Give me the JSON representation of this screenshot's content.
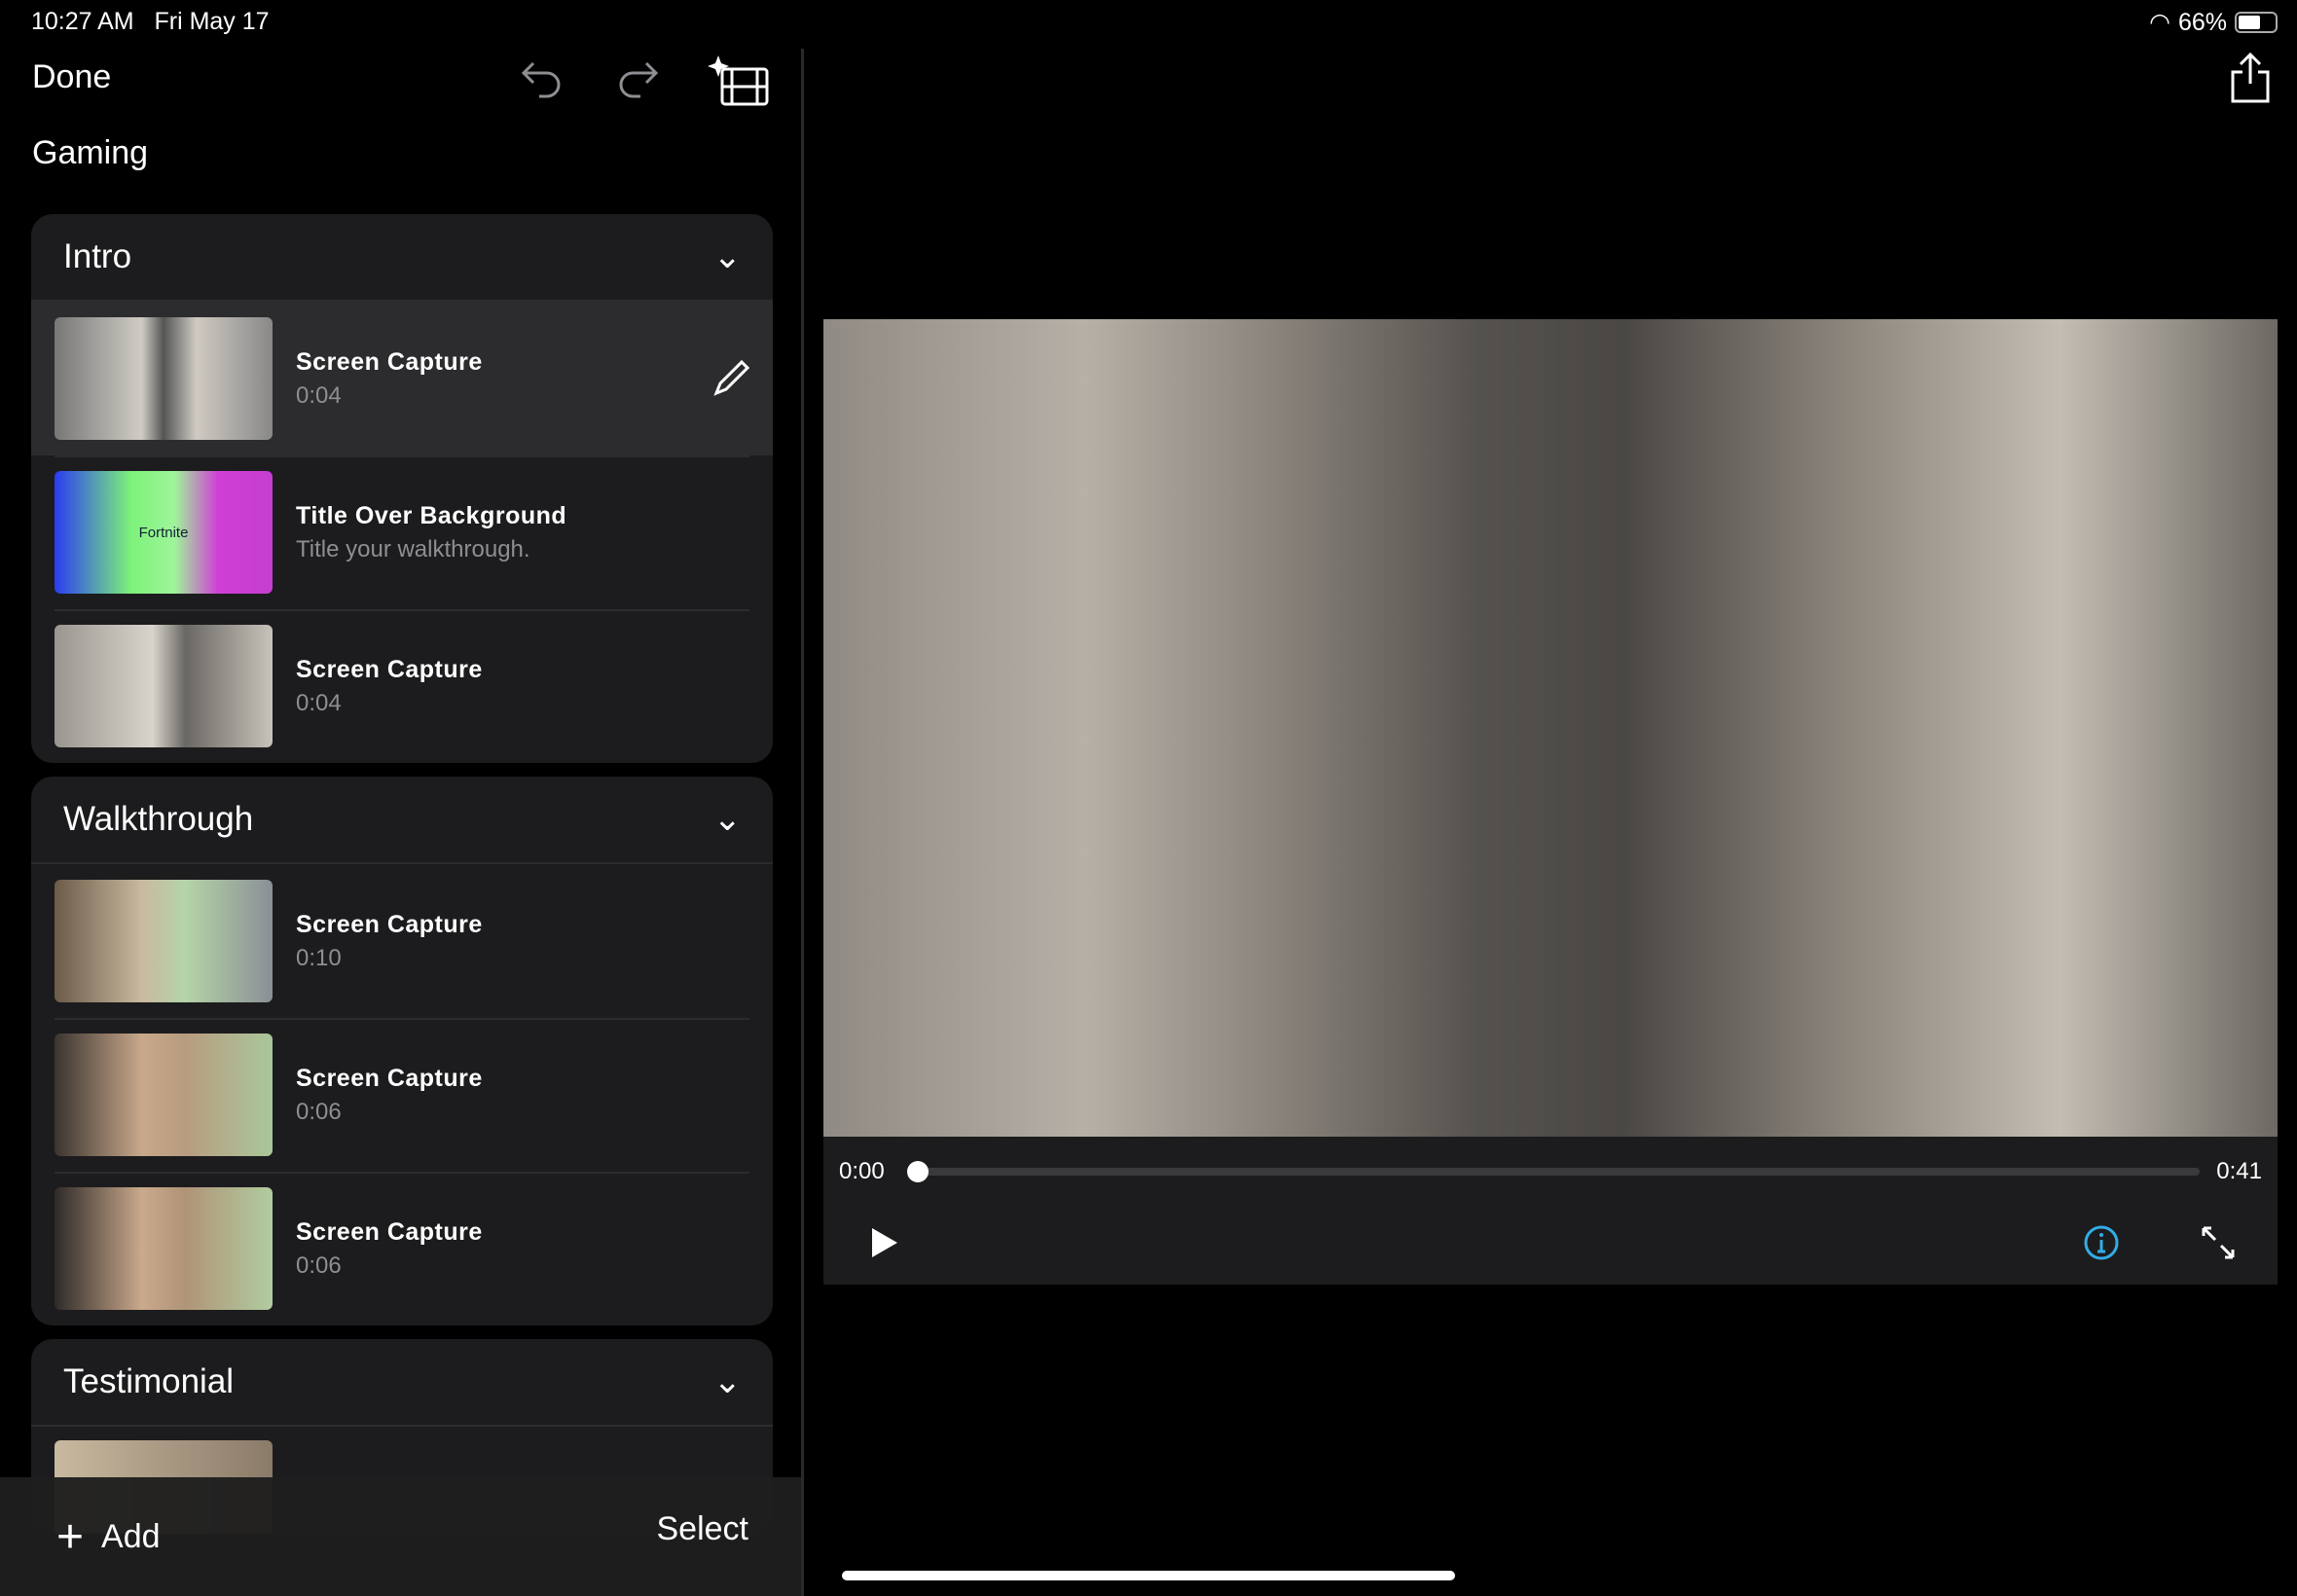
{
  "status": {
    "time": "10:27 AM",
    "date": "Fri May 17",
    "battery": "66%"
  },
  "toolbar": {
    "done": "Done",
    "project_title": "Gaming"
  },
  "sections": [
    {
      "title": "Intro",
      "items": [
        {
          "name": "Screen Capture",
          "sub": "0:04",
          "selected": true
        },
        {
          "name": "Title Over Background",
          "sub": "Title your walkthrough.",
          "thumb_text": "Fortnite"
        },
        {
          "name": "Screen Capture",
          "sub": "0:04"
        }
      ]
    },
    {
      "title": "Walkthrough",
      "items": [
        {
          "name": "Screen Capture",
          "sub": "0:10"
        },
        {
          "name": "Screen Capture",
          "sub": "0:06"
        },
        {
          "name": "Screen Capture",
          "sub": "0:06"
        }
      ]
    },
    {
      "title": "Testimonial",
      "items": []
    }
  ],
  "bottom": {
    "add": "Add",
    "select": "Select"
  },
  "player": {
    "current": "0:00",
    "duration": "0:41",
    "progress": 0,
    "info_color": "#32ade6"
  }
}
